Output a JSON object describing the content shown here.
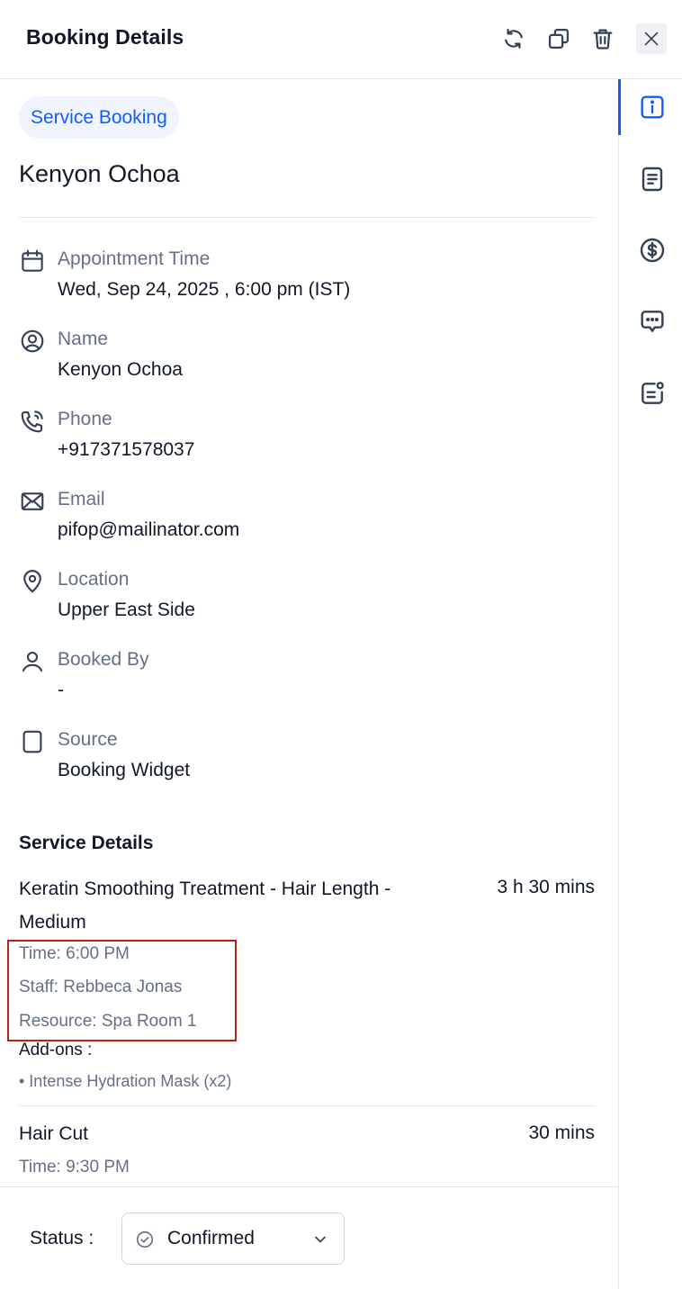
{
  "header": {
    "title": "Booking Details"
  },
  "booking": {
    "type_badge": "Service Booking",
    "customer_name": "Kenyon Ochoa"
  },
  "fields": [
    {
      "label": "Appointment Time",
      "value": "Wed, Sep 24, 2025 , 6:00 pm (IST)",
      "icon": "calendar-icon"
    },
    {
      "label": "Name",
      "value": "Kenyon Ochoa",
      "icon": "user-circle-icon"
    },
    {
      "label": "Phone",
      "value": "+917371578037",
      "icon": "phone-icon"
    },
    {
      "label": "Email",
      "value": "pifop@mailinator.com",
      "icon": "mail-icon"
    },
    {
      "label": "Location",
      "value": "Upper East Side",
      "icon": "map-pin-icon"
    },
    {
      "label": "Booked By",
      "value": "-",
      "icon": "user-icon"
    },
    {
      "label": "Source",
      "value": "Booking Widget",
      "icon": "square-icon"
    }
  ],
  "service_details": {
    "title": "Service Details",
    "services": [
      {
        "name": "Keratin Smoothing Treatment - Hair Length - Medium",
        "duration": "3 h 30 mins",
        "time": "Time: 6:00 PM",
        "staff": "Staff: Rebbeca Jonas",
        "resource": "Resource: Spa Room 1",
        "addons_label": "Add-ons :",
        "addons": [
          "• Intense Hydration Mask (x2)"
        ]
      },
      {
        "name": "Hair Cut",
        "duration": "30 mins",
        "time": "Time: 9:30 PM"
      }
    ]
  },
  "footer": {
    "status_label": "Status :",
    "status_value": "Confirmed"
  },
  "colors": {
    "accent": "#155eef",
    "badge_bg": "#eff4ff",
    "muted_text": "#667085",
    "highlight": "#b42318"
  }
}
